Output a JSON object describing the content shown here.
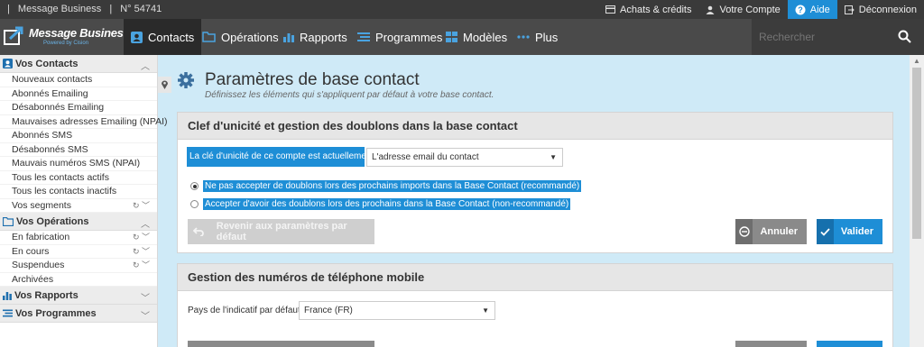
{
  "topbar": {
    "account_sep": "|",
    "brand": "Message Business",
    "sep2": "|",
    "account_no": "N° 54741",
    "achats": "Achats & crédits",
    "compte": "Votre Compte",
    "aide": "Aide",
    "deconnexion": "Déconnexion"
  },
  "logo": {
    "line1": "Message Business",
    "line2": "Powered by Cision"
  },
  "nav": {
    "contacts": "Contacts",
    "operations": "Opérations",
    "rapports": "Rapports",
    "programmes": "Programmes",
    "modeles": "Modèles",
    "plus": "Plus",
    "search_placeholder": "Rechercher"
  },
  "sidebar": {
    "contacts_title": "Vos Contacts",
    "contacts_items": [
      "Nouveaux contacts",
      "Abonnés Emailing",
      "Désabonnés Emailing",
      "Mauvaises adresses Emailing (NPAI)",
      "Abonnés SMS",
      "Désabonnés SMS",
      "Mauvais numéros SMS (NPAI)",
      "Tous les contacts actifs",
      "Tous les contacts inactifs",
      "Vos segments"
    ],
    "operations_title": "Vos Opérations",
    "operations_items": [
      "En fabrication",
      "En cours",
      "Suspendues",
      "Archivées"
    ],
    "rapports_title": "Vos Rapports",
    "programmes_title": "Vos Programmes"
  },
  "page": {
    "title": "Paramètres de base contact",
    "subtitle": "Définissez les éléments qui s'appliquent par défaut à votre base contact."
  },
  "panel1": {
    "title": "Clef d'unicité et gestion des doublons dans la base contact",
    "key_label": "La clé d'unicité de ce compte est actuellement",
    "key_value": "L'adresse email du contact",
    "radio1": "Ne pas accepter de doublons lors des prochains imports dans la Base Contact (recommandé)",
    "radio2": "Accepter d'avoir des doublons lors des prochains dans la Base Contact (non-recommandé)",
    "radio_selected": 1,
    "reset_btn": "Revenir aux paramètres par défaut",
    "cancel_btn": "Annuler",
    "ok_btn": "Valider"
  },
  "panel2": {
    "title": "Gestion des numéros de téléphone mobile",
    "country_label": "Pays de l'indicatif par défaut",
    "country_value": "France (FR)"
  },
  "colors": {
    "accent": "#1e8ed6",
    "topbar": "#3a3a3a",
    "nav": "#4a4a4a",
    "page_bg": "#cfeaf7"
  }
}
